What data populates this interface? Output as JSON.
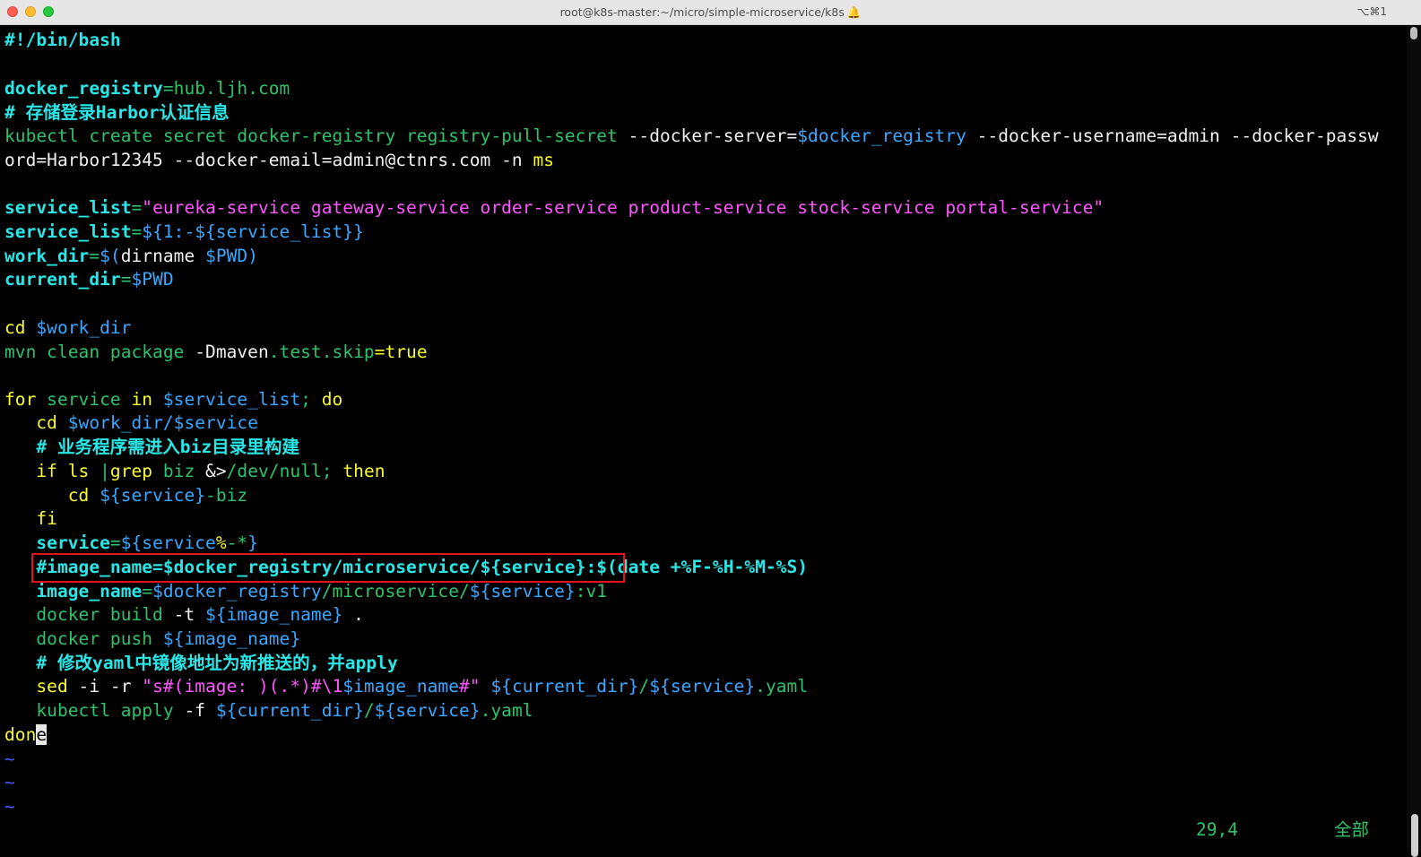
{
  "window": {
    "title": "root@k8s-master:~/micro/simple-microservice/k8s",
    "shortcut": "⌥⌘1"
  },
  "lines": {
    "l1": "#!/bin/bash",
    "l3a": "docker_registry",
    "l3b": "=",
    "l3c": "hub.ljh.com",
    "l4": "# 存储登录Harbor认证信息",
    "l5a": "kubectl create secret docker-registry registry-pull-secret ",
    "l5b": "--docker-server=",
    "l5c": "$docker_registry",
    "l5d": " --docker-username=admin --docker-passw",
    "l6a": "ord=Harbor12345 --docker-email=admin@ctnrs.com -n ",
    "l6b": "ms",
    "l8a": "service_list",
    "l8b": "=",
    "l8c": "\"eureka-service gateway-service order-service product-service stock-service portal-service\"",
    "l9a": "service_list",
    "l9b": "=",
    "l9c": "${1:-${service_list}}",
    "l10a": "work_dir",
    "l10b": "=",
    "l10c": "$(",
    "l10d": "dirname ",
    "l10e": "$PWD",
    "l10f": ")",
    "l11a": "current_dir",
    "l11b": "=",
    "l11c": "$PWD",
    "l13a": "cd ",
    "l13b": "$work_dir",
    "l14a": "mvn clean package ",
    "l14b": "-Dmaven",
    "l14c": ".test.skip",
    "l14d": "=true",
    "l16a": "for ",
    "l16b": "service ",
    "l16c": "in ",
    "l16d": "$service_list",
    "l16e": "; ",
    "l16f": "do",
    "l17a": "   cd ",
    "l17b": "$work_dir",
    "l17c": "/",
    "l17d": "$service",
    "l18": "   # 业务程序需进入biz目录里构建",
    "l19a": "   if ",
    "l19b": "ls ",
    "l19c": "|",
    "l19d": "grep ",
    "l19e": "biz ",
    "l19f": "&>",
    "l19g": "/dev/null",
    "l19h": "; ",
    "l19i": "then",
    "l20a": "      cd ",
    "l20b": "${service}",
    "l20c": "-biz",
    "l21": "   fi",
    "l22a": "   service",
    "l22b": "=",
    "l22c": "${service",
    "l22d": "%",
    "l22e": "-*",
    "l22f": "}",
    "l23": "   #image_name=$docker_registry/microservice/${service}:$(date +%F-%H-%M-%S)",
    "l24a": "   image_name",
    "l24b": "=",
    "l24c": "$docker_registry",
    "l24d": "/microservice/",
    "l24e": "${service}",
    "l24f": ":v1",
    "l25a": "   docker build ",
    "l25b": "-t ",
    "l25c": "${image_name}",
    "l25d": " .",
    "l26a": "   docker push ",
    "l26b": "${image_name}",
    "l27": "   # 修改yaml中镜像地址为新推送的，并apply",
    "l28a": "   sed ",
    "l28b": "-i -r ",
    "l28c": "\"s#(image: )(.*)#\\1",
    "l28d": "$image_name",
    "l28e": "#\"",
    "l28f": " ",
    "l28g": "${current_dir}",
    "l28h": "/",
    "l28i": "${service}",
    "l28j": ".yaml",
    "l29a": "   kubectl apply ",
    "l29b": "-f ",
    "l29c": "${current_dir}",
    "l29d": "/",
    "l29e": "${service}",
    "l29f": ".yaml",
    "l30a": "don",
    "l30b": "e",
    "tilde": "~"
  },
  "status": {
    "position": "29,4",
    "scope": "全部"
  }
}
